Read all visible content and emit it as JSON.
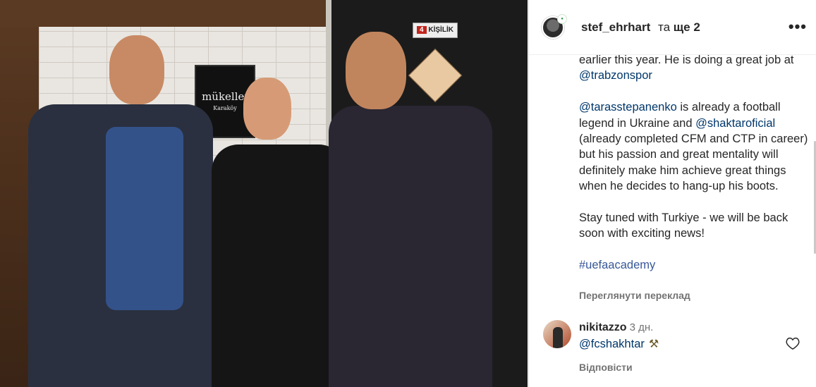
{
  "photo": {
    "sign_text": "mükellef",
    "sign_sub": "Karaköy",
    "door_sign_number": "4",
    "door_sign_word": "KİŞİLİK"
  },
  "header": {
    "username": "stef_ehrhart",
    "and_text": "та",
    "more_text": "ще 2",
    "menu_icon": "more-horizontal-icon"
  },
  "caption": {
    "line1_text": "earlier this year. He is doing a great job at ",
    "mention_trabzonspor": "@trabzonspor",
    "mention_tarasstepanenko": "@tarasstepanenko",
    "p2_text_a": " is already a football legend in Ukraine and ",
    "mention_shaktaroficial": "@shaktaroficial",
    "p2_text_b": " (already completed CFM and CTP in career) but his passion and great mentality will definitely make him achieve great things when he decides to hang-up his boots.",
    "p3_text": "Stay tuned with Turkiye - we will be back soon with exciting news!",
    "hashtag": "#uefaacademy"
  },
  "translate_label": "Переглянути переклад",
  "comment": {
    "username": "nikitazzo",
    "time": "3 дн.",
    "mention": "@fcshakhtar",
    "emoji": "⚒",
    "like_icon": "heart-icon",
    "reply_label": "Відповісти"
  }
}
